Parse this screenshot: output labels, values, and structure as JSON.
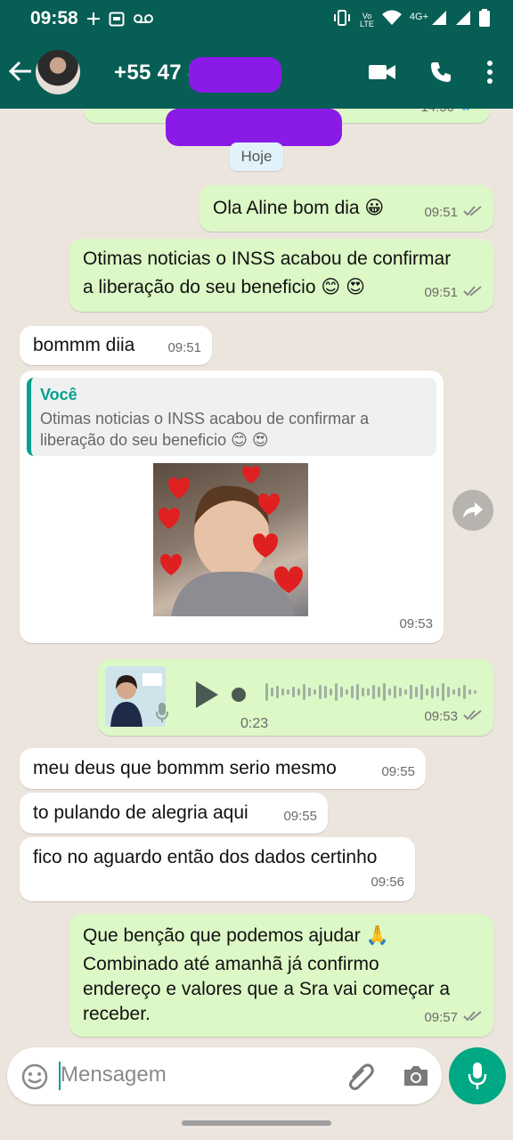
{
  "status_bar": {
    "time": "09:58",
    "network": "4G+",
    "volte_top": "Vo",
    "volte_bottom": "LTE"
  },
  "header": {
    "phone_visible": "+55 47 8",
    "icons": [
      "back-arrow-icon",
      "video-call-icon",
      "voice-call-icon",
      "more-options-icon"
    ]
  },
  "chat": {
    "top_partial_time": "14:50",
    "date_chip": "Hoje",
    "messages": [
      {
        "dir": "out",
        "text": "Ola Aline bom dia 😀",
        "time": "09:51"
      },
      {
        "dir": "out",
        "text_line1": "Otimas noticias o INSS acabou de confirmar",
        "text_line2": "a liberação do seu beneficio 😊 😍",
        "time": "09:51"
      },
      {
        "dir": "in",
        "text": "bommm diia",
        "time": "09:51"
      },
      {
        "dir": "in",
        "quote_author": "Você",
        "quote_line1": "Otimas noticias o INSS acabou de confirmar a",
        "quote_line2": "liberação do seu beneficio 😊 😍",
        "has_image": true,
        "time": "09:53"
      },
      {
        "dir": "out",
        "type": "audio",
        "duration": "0:23",
        "time": "09:53"
      },
      {
        "dir": "in",
        "text": "meu deus que bommm serio mesmo",
        "time": "09:55"
      },
      {
        "dir": "in",
        "text": "to pulando de alegria aqui",
        "time": "09:55"
      },
      {
        "dir": "in",
        "text": "fico no aguardo então dos dados certinho",
        "time": "09:56"
      },
      {
        "dir": "out",
        "line1": "Que benção que podemos ajudar 🙏",
        "line2": "Combinado até amanhã já confirmo",
        "line3": "endereço e valores que a Sra vai começar a",
        "line4": "receber.",
        "time": "09:57"
      }
    ]
  },
  "input": {
    "placeholder": "Mensagem"
  },
  "colors": {
    "header": "#075E54",
    "outgoing": "#DCF8C6",
    "incoming": "#FFFFFF",
    "accent": "#00A884",
    "background": "#ECE5DD"
  }
}
